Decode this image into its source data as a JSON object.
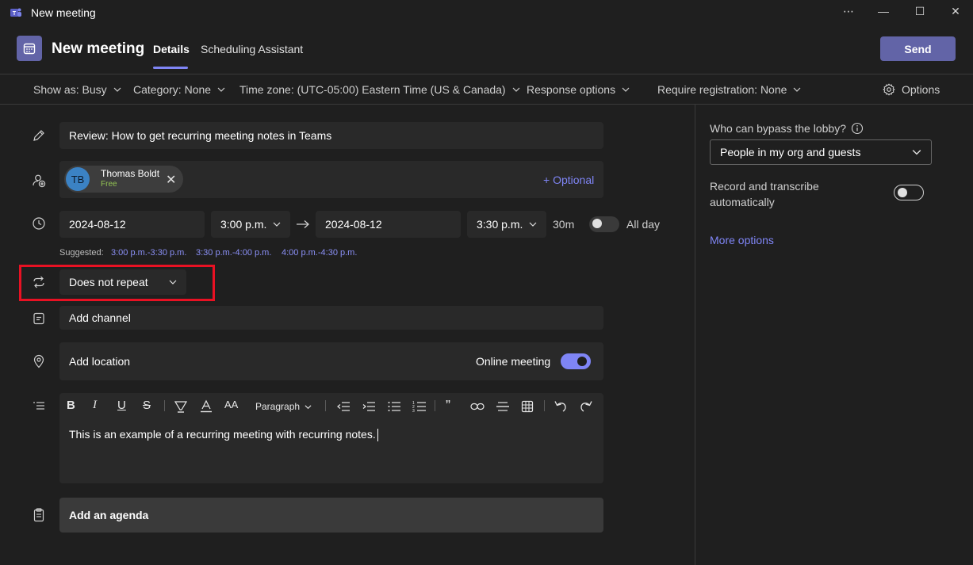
{
  "window": {
    "title": "New meeting",
    "controls": {
      "more": "⋯",
      "minimize": "—",
      "maximize": "☐",
      "close": "✕"
    }
  },
  "header": {
    "title": "New meeting",
    "tabs": [
      {
        "label": "Details",
        "selected": true
      },
      {
        "label": "Scheduling Assistant",
        "selected": false
      }
    ],
    "send_label": "Send"
  },
  "options_bar": {
    "show_as": "Show as: Busy",
    "category": "Category: None",
    "time_zone": "Time zone: (UTC-05:00) Eastern Time (US & Canada)",
    "response_options": "Response options",
    "require_registration": "Require registration: None",
    "options": "Options"
  },
  "form": {
    "title_value": "Review: How to get recurring meeting notes in Teams",
    "attendee": {
      "initials": "TB",
      "name": "Thomas Boldt",
      "status": "Free"
    },
    "optional_link": "+ Optional",
    "start_date": "2024-08-12",
    "start_time": "3:00 p.m.",
    "end_date": "2024-08-12",
    "end_time": "3:30 p.m.",
    "duration": "30m",
    "all_day_label": "All day",
    "all_day_on": false,
    "suggested_label": "Suggested:",
    "suggestions": [
      "3:00 p.m.-3:30 p.m.",
      "3:30 p.m.-4:00 p.m.",
      "4:00 p.m.-4:30 p.m."
    ],
    "repeat_value": "Does not repeat",
    "channel_placeholder": "Add channel",
    "location_placeholder": "Add location",
    "online_meeting_label": "Online meeting",
    "online_meeting_on": true,
    "editor": {
      "paragraph_label": "Paragraph",
      "body_text": "This is an example of a recurring meeting with recurring notes."
    },
    "agenda_label": "Add an agenda"
  },
  "right_pane": {
    "lobby_label": "Who can bypass the lobby?",
    "lobby_value": "People in my org and guests",
    "record_label_line1": "Record and transcribe",
    "record_label_line2": "automatically",
    "record_on": false,
    "more_options": "More options"
  },
  "colors": {
    "accent": "#6264a7",
    "accent_light": "#7f85f5",
    "highlight_box": "#e81123",
    "background": "#1f1f1f",
    "field": "#292929"
  }
}
